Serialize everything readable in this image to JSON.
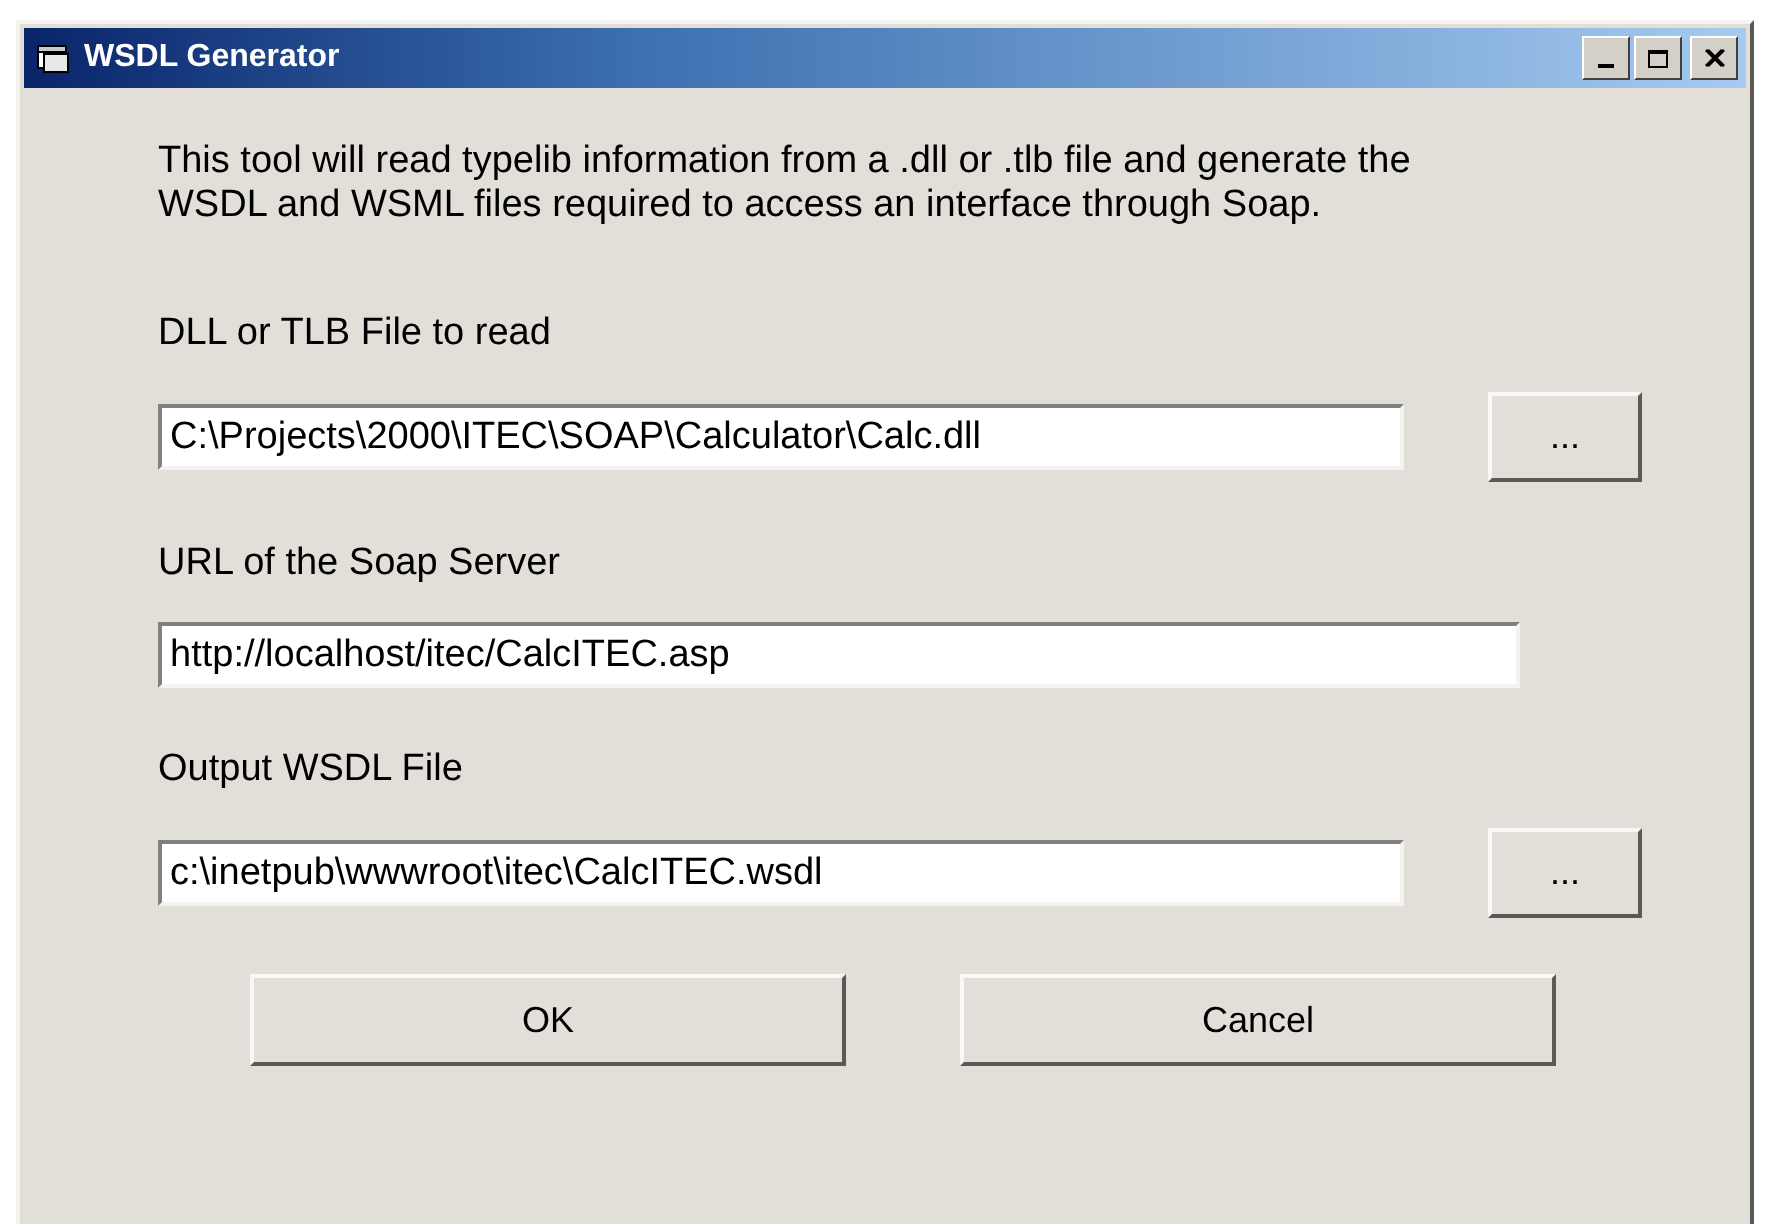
{
  "window": {
    "title": "WSDL Generator"
  },
  "description": "This tool will read typelib information from a .dll or .tlb file and generate the WSDL and WSML files required to access an interface through Soap.",
  "fields": [
    {
      "label": "DLL or TLB File to read",
      "value": "C:\\Projects\\2000\\ITEC\\SOAP\\Calculator\\Calc.dll",
      "browse": "..."
    },
    {
      "label": "URL of the Soap Server",
      "value": "http://localhost/itec/CalcITEC.asp"
    },
    {
      "label": "Output WSDL File",
      "value": "c:\\inetpub\\wwwroot\\itec\\CalcITEC.wsdl",
      "browse": "..."
    }
  ],
  "buttons": [
    "OK",
    "Cancel"
  ]
}
